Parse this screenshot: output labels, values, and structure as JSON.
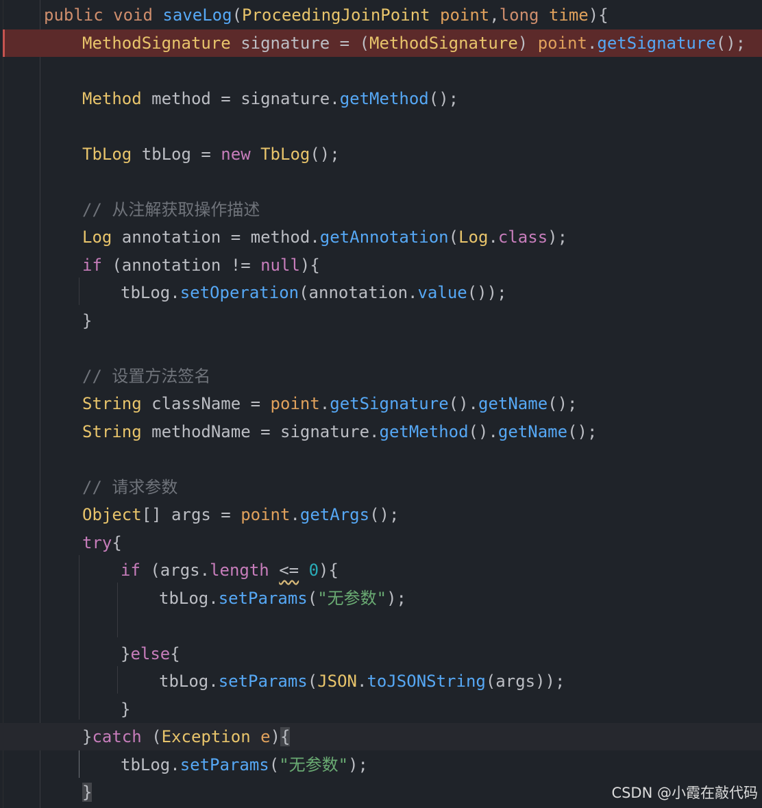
{
  "editor": {
    "lines": [
      {
        "indent": 1,
        "state": "normal",
        "tokens": [
          {
            "t": "public ",
            "c": "kw"
          },
          {
            "t": "void ",
            "c": "kw"
          },
          {
            "t": "saveLog",
            "c": "fn"
          },
          {
            "t": "(",
            "c": "p"
          },
          {
            "t": "ProceedingJoinPoint ",
            "c": "type"
          },
          {
            "t": "point",
            "c": "param"
          },
          {
            "t": ",",
            "c": "p"
          },
          {
            "t": "long ",
            "c": "kw"
          },
          {
            "t": "time",
            "c": "param"
          },
          {
            "t": "){",
            "c": "p"
          }
        ]
      },
      {
        "indent": 2,
        "state": "error",
        "tokens": [
          {
            "t": "MethodSignature ",
            "c": "type"
          },
          {
            "t": "signature = (",
            "c": "p"
          },
          {
            "t": "MethodSignature",
            "c": "type"
          },
          {
            "t": ") ",
            "c": "p"
          },
          {
            "t": "point",
            "c": "param"
          },
          {
            "t": ".",
            "c": "p"
          },
          {
            "t": "getSignature",
            "c": "fn"
          },
          {
            "t": "();",
            "c": "p"
          }
        ]
      },
      {
        "indent": 0,
        "state": "normal",
        "tokens": []
      },
      {
        "indent": 2,
        "state": "normal",
        "tokens": [
          {
            "t": "Method ",
            "c": "type"
          },
          {
            "t": "method = signature.",
            "c": "p"
          },
          {
            "t": "getMethod",
            "c": "fn"
          },
          {
            "t": "();",
            "c": "p"
          }
        ]
      },
      {
        "indent": 0,
        "state": "normal",
        "tokens": []
      },
      {
        "indent": 2,
        "state": "normal",
        "tokens": [
          {
            "t": "TbLog ",
            "c": "type"
          },
          {
            "t": "tbLog = ",
            "c": "p"
          },
          {
            "t": "new ",
            "c": "kwp"
          },
          {
            "t": "TbLog",
            "c": "type"
          },
          {
            "t": "();",
            "c": "p"
          }
        ]
      },
      {
        "indent": 0,
        "state": "normal",
        "tokens": []
      },
      {
        "indent": 2,
        "state": "normal",
        "tokens": [
          {
            "t": "// 从注解获取操作描述",
            "c": "cmt"
          }
        ]
      },
      {
        "indent": 2,
        "state": "normal",
        "tokens": [
          {
            "t": "Log ",
            "c": "type"
          },
          {
            "t": "annotation = method.",
            "c": "p"
          },
          {
            "t": "getAnnotation",
            "c": "fn"
          },
          {
            "t": "(",
            "c": "p"
          },
          {
            "t": "Log",
            "c": "type"
          },
          {
            "t": ".",
            "c": "p"
          },
          {
            "t": "class",
            "c": "kwp"
          },
          {
            "t": ");",
            "c": "p"
          }
        ]
      },
      {
        "indent": 2,
        "state": "normal",
        "tokens": [
          {
            "t": "if ",
            "c": "kwp"
          },
          {
            "t": "(annotation != ",
            "c": "p"
          },
          {
            "t": "null",
            "c": "kwp"
          },
          {
            "t": "){",
            "c": "p"
          }
        ]
      },
      {
        "indent": 3,
        "state": "normal",
        "tokens": [
          {
            "t": "tbLog.",
            "c": "p"
          },
          {
            "t": "setOperation",
            "c": "fn"
          },
          {
            "t": "(annotation.",
            "c": "p"
          },
          {
            "t": "value",
            "c": "fn"
          },
          {
            "t": "());",
            "c": "p"
          }
        ]
      },
      {
        "indent": 2,
        "state": "normal",
        "tokens": [
          {
            "t": "}",
            "c": "p"
          }
        ]
      },
      {
        "indent": 0,
        "state": "normal",
        "tokens": []
      },
      {
        "indent": 2,
        "state": "normal",
        "tokens": [
          {
            "t": "// 设置方法签名",
            "c": "cmt"
          }
        ]
      },
      {
        "indent": 2,
        "state": "normal",
        "tokens": [
          {
            "t": "String ",
            "c": "type"
          },
          {
            "t": "className = ",
            "c": "p"
          },
          {
            "t": "point",
            "c": "param"
          },
          {
            "t": ".",
            "c": "p"
          },
          {
            "t": "getSignature",
            "c": "fn"
          },
          {
            "t": "().",
            "c": "p"
          },
          {
            "t": "getName",
            "c": "fn"
          },
          {
            "t": "();",
            "c": "p"
          }
        ]
      },
      {
        "indent": 2,
        "state": "normal",
        "tokens": [
          {
            "t": "String ",
            "c": "type"
          },
          {
            "t": "methodName = signature.",
            "c": "p"
          },
          {
            "t": "getMethod",
            "c": "fn"
          },
          {
            "t": "().",
            "c": "p"
          },
          {
            "t": "getName",
            "c": "fn"
          },
          {
            "t": "();",
            "c": "p"
          }
        ]
      },
      {
        "indent": 0,
        "state": "normal",
        "tokens": []
      },
      {
        "indent": 2,
        "state": "normal",
        "tokens": [
          {
            "t": "// 请求参数",
            "c": "cmt"
          }
        ]
      },
      {
        "indent": 2,
        "state": "normal",
        "tokens": [
          {
            "t": "Object",
            "c": "type"
          },
          {
            "t": "[] args = ",
            "c": "p"
          },
          {
            "t": "point",
            "c": "param"
          },
          {
            "t": ".",
            "c": "p"
          },
          {
            "t": "getArgs",
            "c": "fn"
          },
          {
            "t": "();",
            "c": "p"
          }
        ]
      },
      {
        "indent": 2,
        "state": "normal",
        "tokens": [
          {
            "t": "try",
            "c": "kwp"
          },
          {
            "t": "{",
            "c": "p"
          }
        ]
      },
      {
        "indent": 3,
        "state": "normal",
        "tokens": [
          {
            "t": "if ",
            "c": "kwp"
          },
          {
            "t": "(args.",
            "c": "p"
          },
          {
            "t": "length",
            "c": "field"
          },
          {
            "t": " ",
            "c": "p"
          },
          {
            "t": "<=",
            "c": "warn"
          },
          {
            "t": " ",
            "c": "p"
          },
          {
            "t": "0",
            "c": "num"
          },
          {
            "t": "){",
            "c": "p"
          }
        ]
      },
      {
        "indent": 4,
        "state": "normal",
        "tokens": [
          {
            "t": "tbLog.",
            "c": "p"
          },
          {
            "t": "setParams",
            "c": "fn"
          },
          {
            "t": "(",
            "c": "p"
          },
          {
            "t": "\"无参数\"",
            "c": "str"
          },
          {
            "t": ");",
            "c": "p"
          }
        ]
      },
      {
        "indent": 0,
        "state": "normal",
        "tokens": []
      },
      {
        "indent": 3,
        "state": "normal",
        "tokens": [
          {
            "t": "}",
            "c": "p"
          },
          {
            "t": "else",
            "c": "kwp"
          },
          {
            "t": "{",
            "c": "p"
          }
        ]
      },
      {
        "indent": 4,
        "state": "normal",
        "tokens": [
          {
            "t": "tbLog.",
            "c": "p"
          },
          {
            "t": "setParams",
            "c": "fn"
          },
          {
            "t": "(",
            "c": "p"
          },
          {
            "t": "JSON",
            "c": "type"
          },
          {
            "t": ".",
            "c": "p"
          },
          {
            "t": "toJSONString",
            "c": "fn"
          },
          {
            "t": "(args));",
            "c": "p"
          }
        ]
      },
      {
        "indent": 3,
        "state": "normal",
        "tokens": [
          {
            "t": "}",
            "c": "p"
          }
        ]
      },
      {
        "indent": 2,
        "state": "caret",
        "tokens": [
          {
            "t": "}",
            "c": "p"
          },
          {
            "t": "catch ",
            "c": "kwp"
          },
          {
            "t": "(",
            "c": "p"
          },
          {
            "t": "Exception ",
            "c": "type"
          },
          {
            "t": "e",
            "c": "param"
          },
          {
            "t": ")",
            "c": "p"
          },
          {
            "t": "{",
            "c": "bracehl"
          }
        ]
      },
      {
        "indent": 3,
        "state": "normal",
        "tokens": [
          {
            "t": "tbLog.",
            "c": "p"
          },
          {
            "t": "setParams",
            "c": "fn"
          },
          {
            "t": "(",
            "c": "p"
          },
          {
            "t": "\"无参数\"",
            "c": "str"
          },
          {
            "t": ");",
            "c": "p"
          }
        ]
      },
      {
        "indent": 2,
        "state": "normal",
        "tokens": [
          {
            "t": "}",
            "c": "bracehl"
          }
        ]
      }
    ]
  },
  "watermark": "CSDN @小霞在敲代码"
}
